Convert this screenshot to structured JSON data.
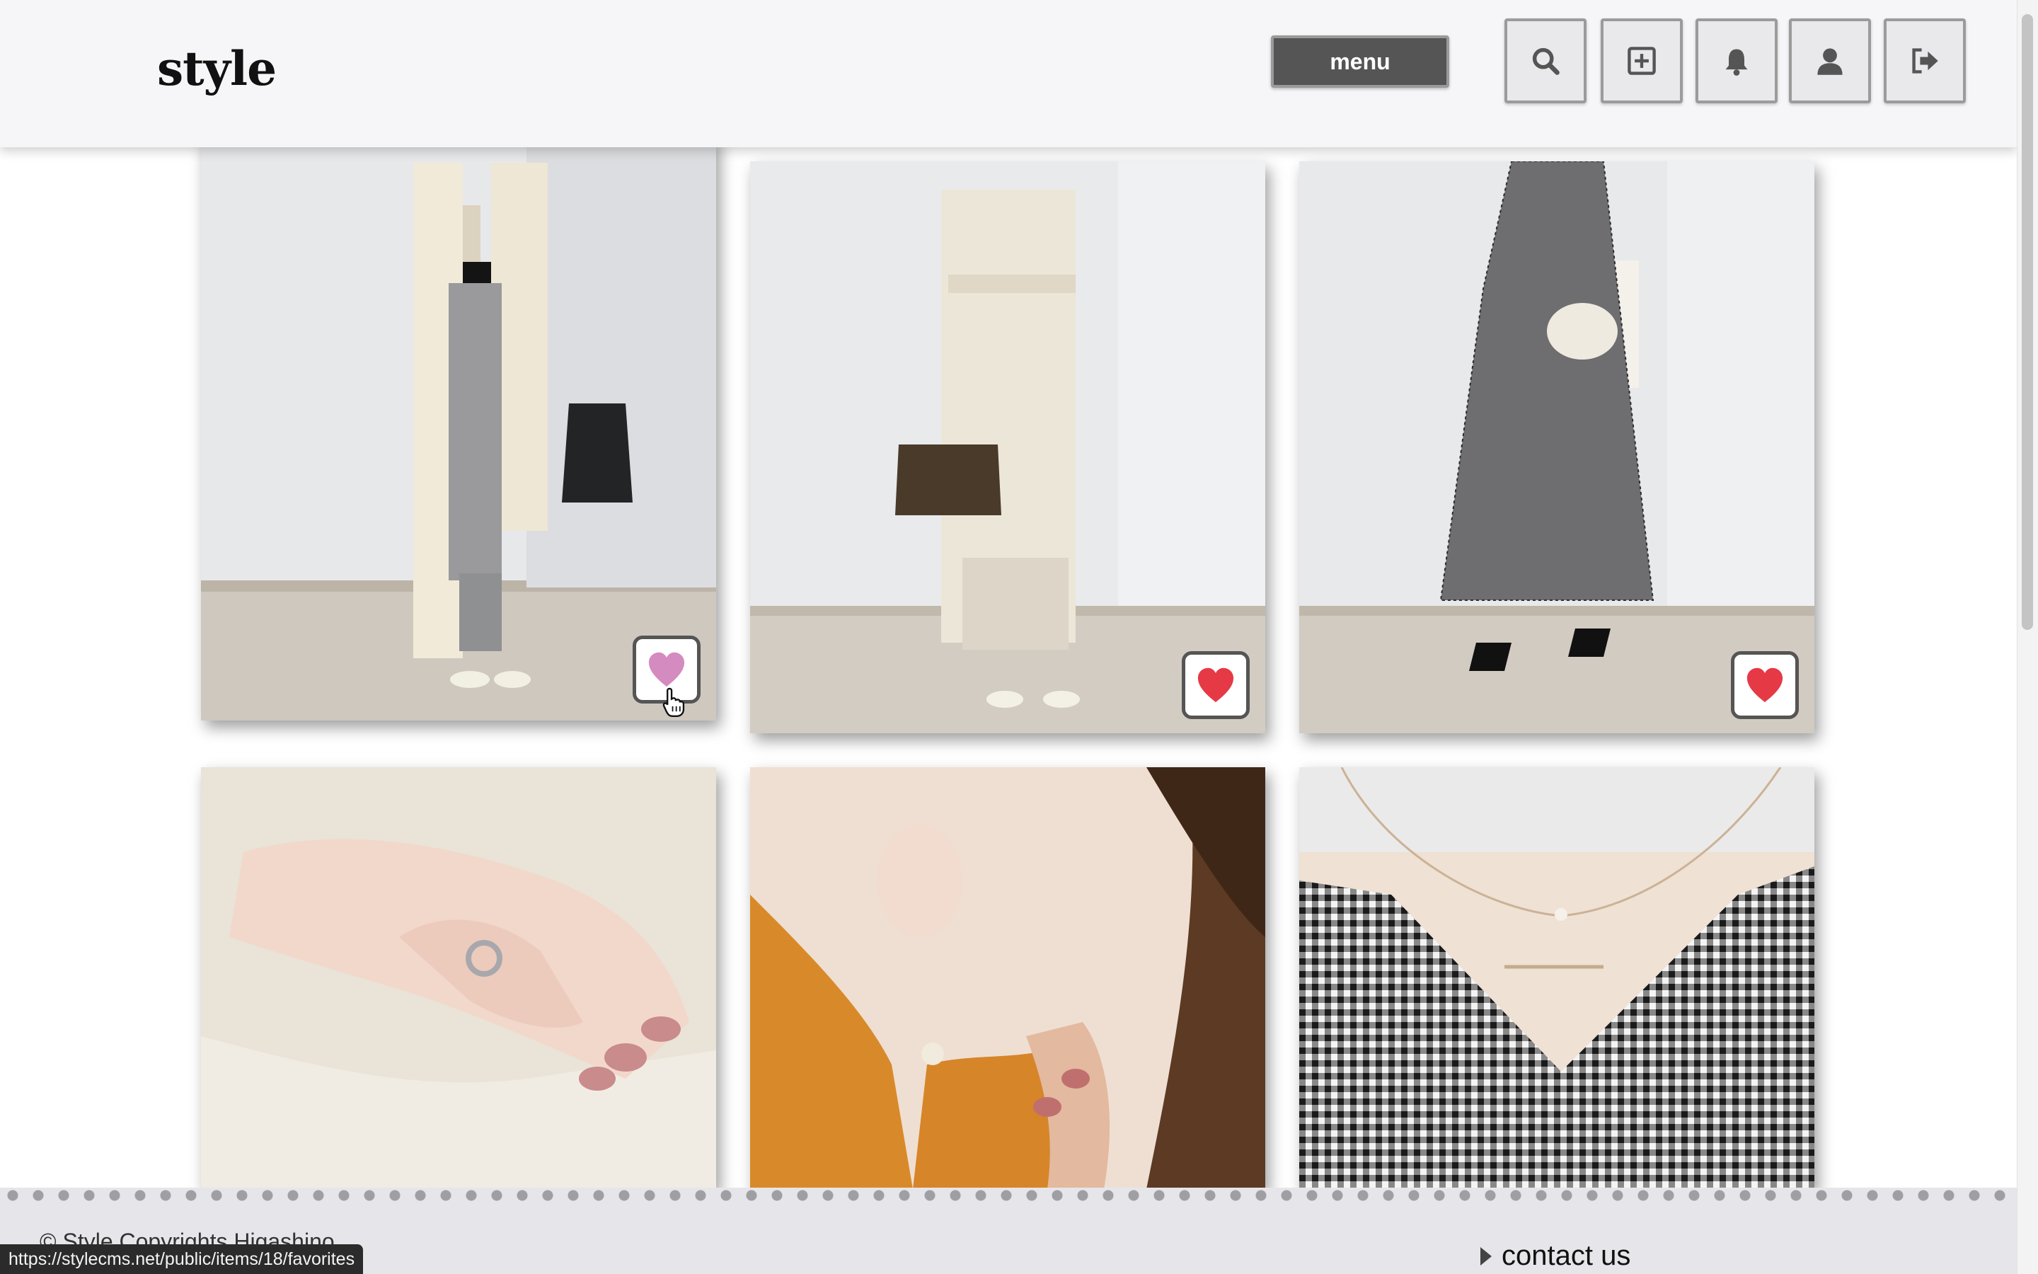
{
  "header": {
    "logo": "style",
    "menu_label": "menu",
    "icons": [
      "search-icon",
      "add-post-icon",
      "bell-icon",
      "user-icon",
      "logout-icon"
    ]
  },
  "posts": [
    {
      "name": "outfit-long-vest-jeans",
      "favorited": true,
      "hover": true
    },
    {
      "name": "outfit-belted-vest-speedy-bag",
      "favorited": true,
      "hover": false
    },
    {
      "name": "outfit-gingham-dress",
      "favorited": true,
      "hover": false
    },
    {
      "name": "ring-on-hand-lace",
      "favorited": false
    },
    {
      "name": "necklace-orange-cardigan",
      "favorited": false
    },
    {
      "name": "necklace-gingham-top",
      "favorited": false
    }
  ],
  "footer": {
    "copyright": "© Style Copyrights Higashino",
    "contact_label": "contact us"
  },
  "status_bar_url": "https://stylecms.net/public/items/18/favorites",
  "colors": {
    "heart_active": "#e63946",
    "heart_hover": "#d48bc0",
    "header_bg": "#f6f6f8",
    "menu_bg": "#555555",
    "footer_bg": "#e6e6ea"
  }
}
